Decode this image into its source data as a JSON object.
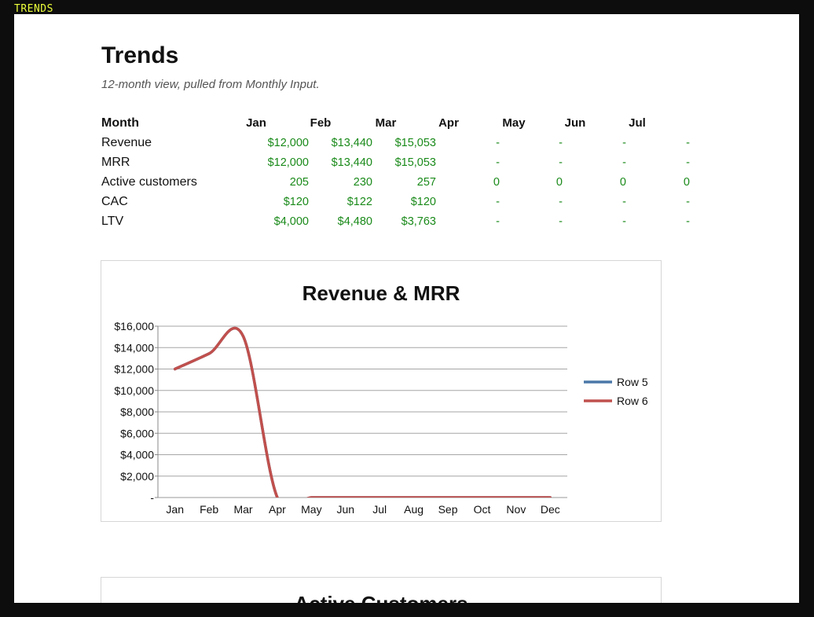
{
  "window_tag": "TRENDS",
  "page": {
    "title": "Trends",
    "subtitle": "12-month view, pulled from Monthly Input."
  },
  "table": {
    "header_label": "Month",
    "months": [
      "Jan",
      "Feb",
      "Mar",
      "Apr",
      "May",
      "Jun",
      "Jul"
    ],
    "rows": [
      {
        "label": "Revenue",
        "values": [
          "$12,000",
          "$13,440",
          "$15,053",
          "-",
          "-",
          "-",
          "-"
        ]
      },
      {
        "label": "MRR",
        "values": [
          "$12,000",
          "$13,440",
          "$15,053",
          "-",
          "-",
          "-",
          "-"
        ]
      },
      {
        "label": "Active customers",
        "values": [
          "205",
          "230",
          "257",
          "0",
          "0",
          "0",
          "0"
        ]
      },
      {
        "label": "CAC",
        "values": [
          "$120",
          "$122",
          "$120",
          "-",
          "-",
          "-",
          "-"
        ]
      },
      {
        "label": "LTV",
        "values": [
          "$4,000",
          "$4,480",
          "$3,763",
          "-",
          "-",
          "-",
          "-"
        ]
      }
    ],
    "value_color": "#1a8a1a"
  },
  "chart_data": {
    "type": "line",
    "title": "Revenue & MRR",
    "categories": [
      "Jan",
      "Feb",
      "Mar",
      "Apr",
      "May",
      "Jun",
      "Jul",
      "Aug",
      "Sep",
      "Oct",
      "Nov",
      "Dec"
    ],
    "y_tick_labels": [
      "-",
      "$2,000",
      "$4,000",
      "$6,000",
      "$8,000",
      "$10,000",
      "$12,000",
      "$14,000",
      "$16,000"
    ],
    "ylim": [
      0,
      16000
    ],
    "grid": true,
    "legend_position": "right",
    "series": [
      {
        "name": "Row 5",
        "color": "#4a78a8",
        "values": [
          12000,
          13440,
          15053,
          0,
          0,
          0,
          0,
          0,
          0,
          0,
          0,
          0
        ]
      },
      {
        "name": "Row 6",
        "color": "#c0504d",
        "values": [
          12000,
          13440,
          15053,
          0,
          0,
          0,
          0,
          0,
          0,
          0,
          0,
          0
        ]
      }
    ]
  },
  "second_chart": {
    "title": "Active Customers"
  }
}
